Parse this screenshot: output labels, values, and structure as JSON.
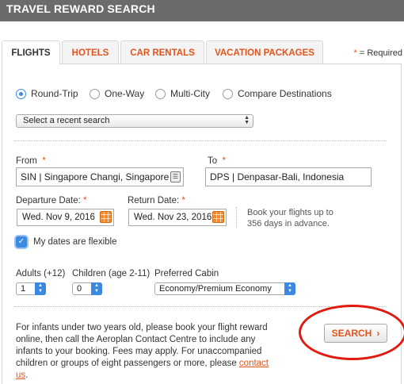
{
  "header": {
    "title": "TRAVEL REWARD SEARCH"
  },
  "tabs": [
    {
      "label": "FLIGHTS",
      "active": true
    },
    {
      "label": "HOTELS"
    },
    {
      "label": "CAR RENTALS"
    },
    {
      "label": "VACATION PACKAGES"
    }
  ],
  "required_note": {
    "star": "*",
    "text": " = Required"
  },
  "trip_types": [
    {
      "label": "Round-Trip",
      "selected": true
    },
    {
      "label": "One-Way"
    },
    {
      "label": "Multi-City"
    },
    {
      "label": "Compare Destinations"
    }
  ],
  "recent_search": {
    "value": "Select a recent search"
  },
  "from": {
    "label": "From",
    "value": "SIN | Singapore Changi, Singapore"
  },
  "to": {
    "label": "To",
    "value": "DPS | Denpasar-Bali, Indonesia"
  },
  "departure": {
    "label": "Departure Date:",
    "value": "Wed. Nov 9, 2016"
  },
  "return": {
    "label": "Return Date:",
    "value": "Wed. Nov 23, 2016"
  },
  "advance_note": "Book your flights up to 356 days in advance.",
  "flexible": {
    "label": "My dates are flexible",
    "checked": true
  },
  "adults": {
    "label": "Adults (+12)",
    "value": "1"
  },
  "children": {
    "label": "Children (age 2-11)",
    "value": "0"
  },
  "cabin": {
    "label": "Preferred Cabin",
    "value": "Economy/Premium Economy"
  },
  "info": {
    "text": "For infants under two years old, please book your flight reward online, then call the Aeroplan Contact Centre to include any infants to your booking. Fees may apply. For unaccompanied children or groups of eight passengers or more, please ",
    "link": "contact us",
    "end": "."
  },
  "search_button": {
    "label": "SEARCH",
    "arrow": "›"
  },
  "colors": {
    "accent": "#e5531a",
    "header_bg": "#6b6b6b",
    "select_blue": "#3b89e0",
    "highlight_red": "#e01b12"
  }
}
